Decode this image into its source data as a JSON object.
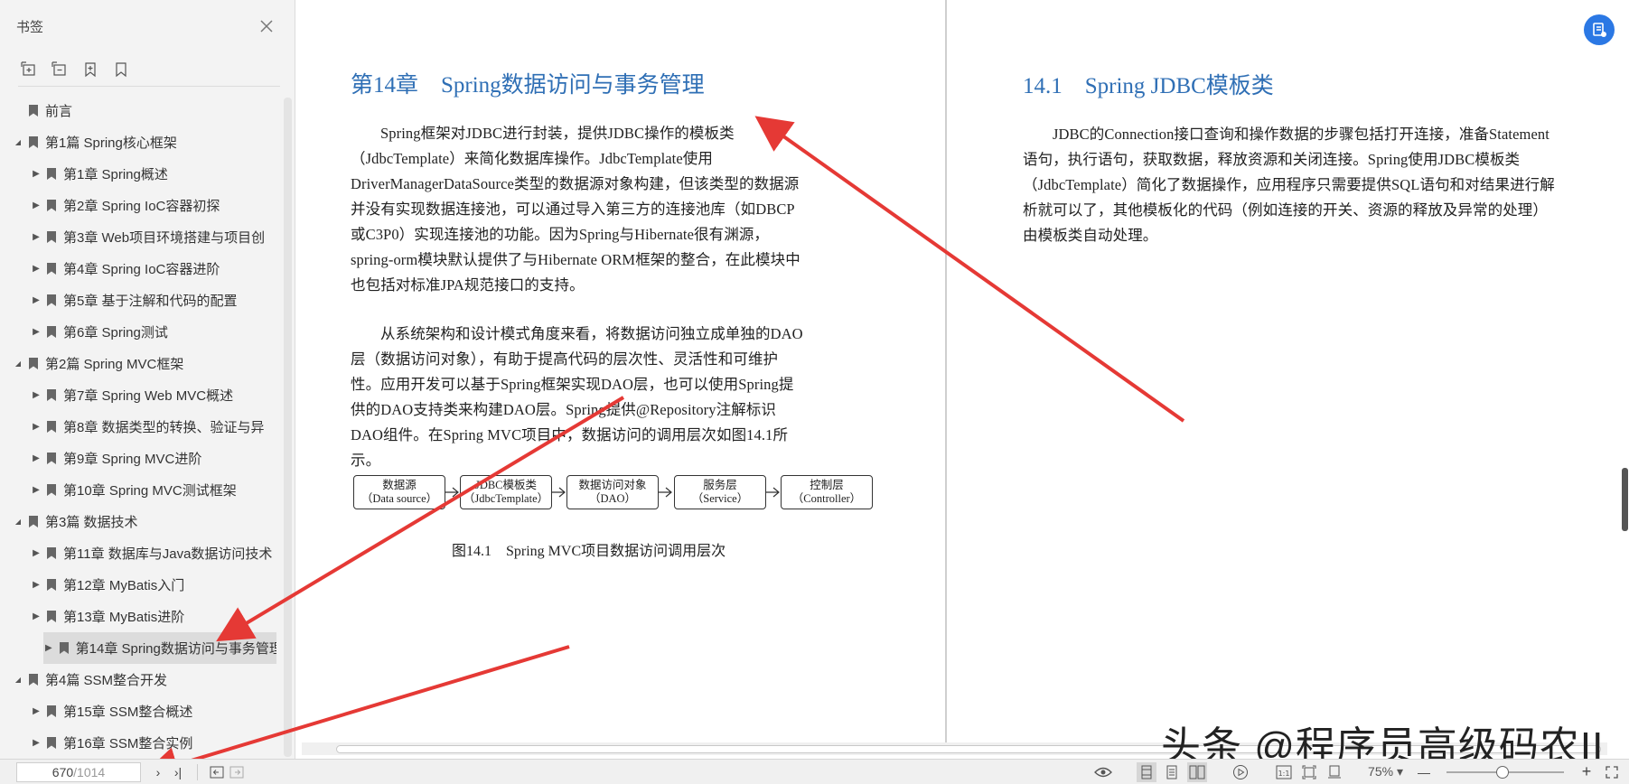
{
  "sidebar": {
    "title": "书签",
    "toolbar_icons": [
      "expand-all-icon",
      "collapse-all-icon",
      "add-bookmark-icon",
      "bookmark-icon"
    ],
    "items": [
      {
        "label": "前言",
        "level": 0,
        "caret": false,
        "selected": false
      },
      {
        "label": "第1篇 Spring核心框架",
        "level": 0,
        "caret": true,
        "expanded": true,
        "selected": false
      },
      {
        "label": "第1章 Spring概述",
        "level": 1,
        "caret": true,
        "selected": false
      },
      {
        "label": "第2章 Spring IoC容器初探",
        "level": 1,
        "caret": true,
        "selected": false
      },
      {
        "label": "第3章 Web项目环境搭建与项目创",
        "level": 1,
        "caret": true,
        "selected": false
      },
      {
        "label": "第4章 Spring IoC容器进阶",
        "level": 1,
        "caret": true,
        "selected": false
      },
      {
        "label": "第5章 基于注解和代码的配置",
        "level": 1,
        "caret": true,
        "selected": false
      },
      {
        "label": "第6章 Spring测试",
        "level": 1,
        "caret": true,
        "selected": false
      },
      {
        "label": "第2篇 Spring MVC框架",
        "level": 0,
        "caret": true,
        "expanded": true,
        "selected": false
      },
      {
        "label": "第7章 Spring Web MVC概述",
        "level": 1,
        "caret": true,
        "selected": false
      },
      {
        "label": "第8章 数据类型的转换、验证与异",
        "level": 1,
        "caret": true,
        "selected": false
      },
      {
        "label": "第9章 Spring MVC进阶",
        "level": 1,
        "caret": true,
        "selected": false
      },
      {
        "label": "第10章 Spring MVC测试框架",
        "level": 1,
        "caret": true,
        "selected": false
      },
      {
        "label": "第3篇 数据技术",
        "level": 0,
        "caret": true,
        "expanded": true,
        "selected": false
      },
      {
        "label": "第11章 数据库与Java数据访问技术",
        "level": 1,
        "caret": true,
        "selected": false
      },
      {
        "label": "第12章 MyBatis入门",
        "level": 1,
        "caret": true,
        "selected": false
      },
      {
        "label": "第13章 MyBatis进阶",
        "level": 1,
        "caret": true,
        "selected": false
      },
      {
        "label": "第14章 Spring数据访问与事务管理",
        "level": 1,
        "caret": true,
        "selected": true
      },
      {
        "label": "第4篇 SSM整合开发",
        "level": 0,
        "caret": true,
        "expanded": true,
        "selected": false
      },
      {
        "label": "第15章 SSM整合概述",
        "level": 1,
        "caret": true,
        "selected": false
      },
      {
        "label": "第16章 SSM整合实例",
        "level": 1,
        "caret": true,
        "selected": false
      }
    ]
  },
  "left_page": {
    "chapter_title": "第14章　Spring数据访问与事务管理",
    "para1": "Spring框架对JDBC进行封装，提供JDBC操作的模板类（JdbcTemplate）来简化数据库操作。JdbcTemplate使用DriverManagerDataSource类型的数据源对象构建，但该类型的数据源并没有实现数据连接池，可以通过导入第三方的连接池库（如DBCP或C3P0）实现连接池的功能。因为Spring与Hibernate很有渊源，spring-orm模块默认提供了与Hibernate ORM框架的整合，在此模块中也包括对标准JPA规范接口的支持。",
    "para2": "从系统架构和设计模式角度来看，将数据访问独立成单独的DAO层（数据访问对象），有助于提高代码的层次性、灵活性和可维护性。应用开发可以基于Spring框架实现DAO层，也可以使用Spring提供的DAO支持类来构建DAO层。Spring提供@Repository注解标识DAO组件。在Spring MVC项目中，数据访问的调用层次如图14.1所示。",
    "flow": [
      {
        "line1": "数据源",
        "line2": "（Data source）"
      },
      {
        "line1": "JDBC模板类",
        "line2": "（JdbcTemplate）"
      },
      {
        "line1": "数据访问对象",
        "line2": "（DAO）"
      },
      {
        "line1": "服务层",
        "line2": "（Service）"
      },
      {
        "line1": "控制层",
        "line2": "（Controller）"
      }
    ],
    "figure_caption": "图14.1　Spring MVC项目数据访问调用层次"
  },
  "right_page": {
    "section_title": "14.1　Spring JDBC模板类",
    "para1": "JDBC的Connection接口查询和操作数据的步骤包括打开连接，准备Statement语句，执行语句，获取数据，释放资源和关闭连接。Spring使用JDBC模板类（JdbcTemplate）简化了数据操作，应用程序只需要提供SQL语句和对结果进行解析就可以了，其他模板化的代码（例如连接的开关、资源的释放及异常的处理）由模板类自动处理。"
  },
  "watermark": "头条 @程序员高级码农II",
  "statusbar": {
    "current_page": "670",
    "total_pages": "/1014",
    "next": "›",
    "last": "›|",
    "zoom": "75%",
    "zoom_level_percent": 75
  },
  "colors": {
    "accent": "#2f6fb5",
    "annotation_arrow": "#e53935",
    "float_button": "#2b78e4"
  }
}
